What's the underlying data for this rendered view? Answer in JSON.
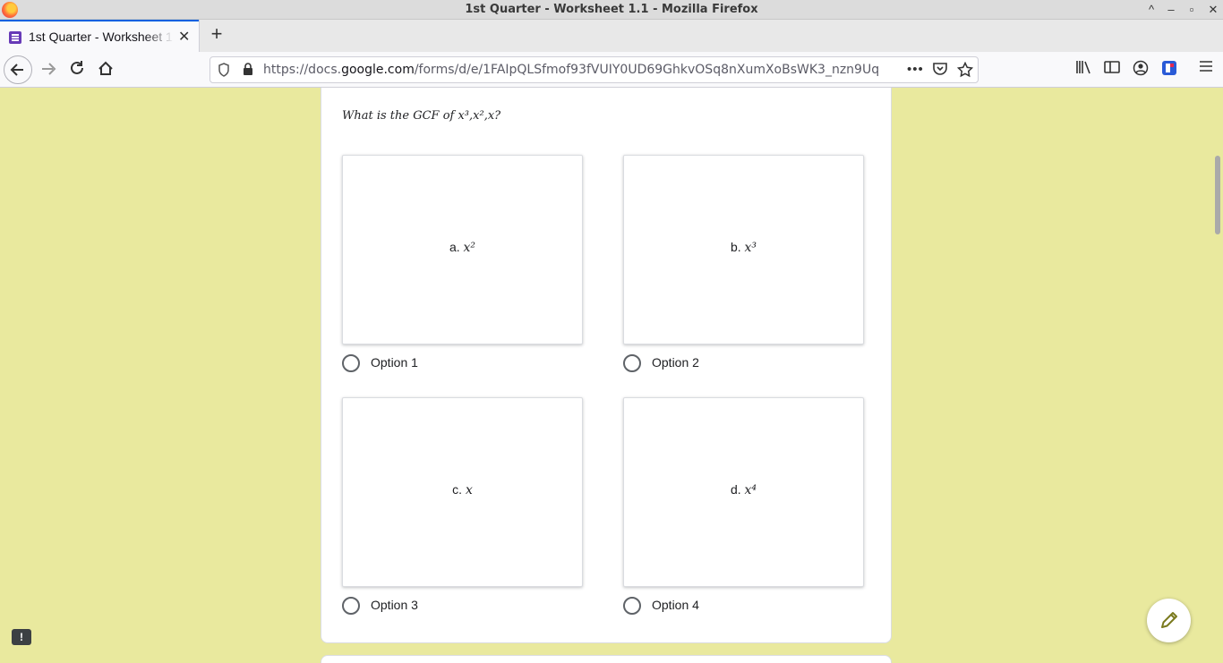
{
  "window": {
    "title": "1st Quarter - Worksheet 1.1 - Mozilla Firefox",
    "controls": [
      "^",
      "–",
      "▫",
      "✕"
    ]
  },
  "tab": {
    "label": "1st Quarter - Worksheet 1.1",
    "close": "✕",
    "new_tab": "+"
  },
  "nav": {
    "url_prefix": "https://docs.",
    "url_domain": "google.com",
    "url_path": "/forms/d/e/1FAIpQLSfmof93fVUIY0UD69GhkvOSq8nXumXoBsWK3_nzn9Uq",
    "more": "•••"
  },
  "form": {
    "question": "What is the GCF of x³,x²,x?",
    "options": [
      {
        "image_label": "a.",
        "image_math": "x²",
        "label": "Option 1"
      },
      {
        "image_label": "b.",
        "image_math": "x³",
        "label": "Option 2"
      },
      {
        "image_label": "c.",
        "image_math": "x",
        "label": "Option 3"
      },
      {
        "image_label": "d.",
        "image_math": "x⁴",
        "label": "Option 4"
      }
    ]
  },
  "report_icon": "!",
  "icons": {
    "back": "back-arrow-icon",
    "forward": "forward-arrow-icon",
    "reload": "reload-icon",
    "home": "home-icon",
    "edit": "pencil-icon"
  }
}
